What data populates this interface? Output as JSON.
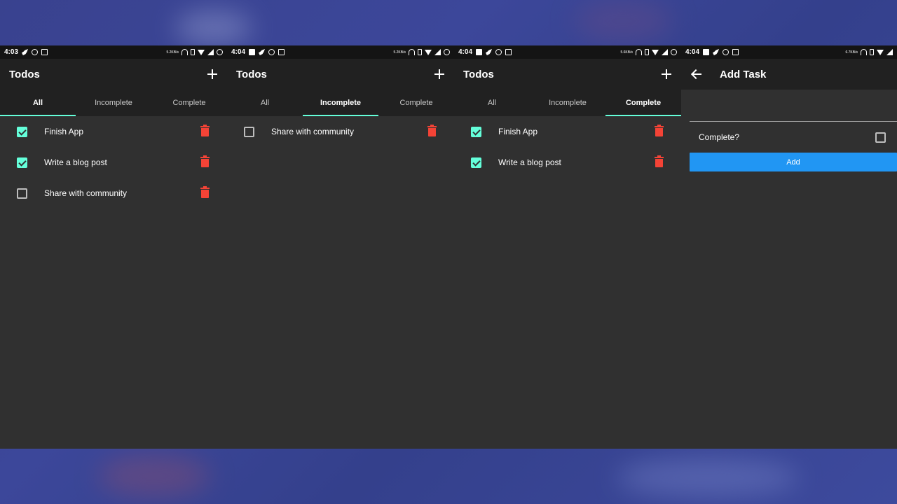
{
  "screens": [
    {
      "status": {
        "time": "4:03",
        "speed": "5.2KB/s"
      },
      "title": "Todos",
      "tabs": [
        "All",
        "Incomplete",
        "Complete"
      ],
      "active_tab": 0,
      "items": [
        {
          "label": "Finish App",
          "checked": true
        },
        {
          "label": "Write a blog post",
          "checked": true
        },
        {
          "label": "Share with community",
          "checked": false
        }
      ]
    },
    {
      "status": {
        "time": "4:04",
        "speed": "5.2KB/s"
      },
      "title": "Todos",
      "tabs": [
        "All",
        "Incomplete",
        "Complete"
      ],
      "active_tab": 1,
      "items": [
        {
          "label": "Share with community",
          "checked": false
        }
      ]
    },
    {
      "status": {
        "time": "4:04",
        "speed": "5.6KB/s"
      },
      "title": "Todos",
      "tabs": [
        "All",
        "Incomplete",
        "Complete"
      ],
      "active_tab": 2,
      "items": [
        {
          "label": "Finish App",
          "checked": true
        },
        {
          "label": "Write a blog post",
          "checked": true
        }
      ]
    }
  ],
  "add_screen": {
    "status": {
      "time": "4:04",
      "speed": "6.7KB/s"
    },
    "title": "Add Task",
    "task_value": "",
    "complete_label": "Complete?",
    "complete_checked": false,
    "add_label": "Add"
  },
  "colors": {
    "accent": "#64ffda",
    "delete": "#f44336",
    "button": "#2196f3",
    "appbar": "#212121",
    "surface": "#303030",
    "backdrop": "#3c479a"
  }
}
